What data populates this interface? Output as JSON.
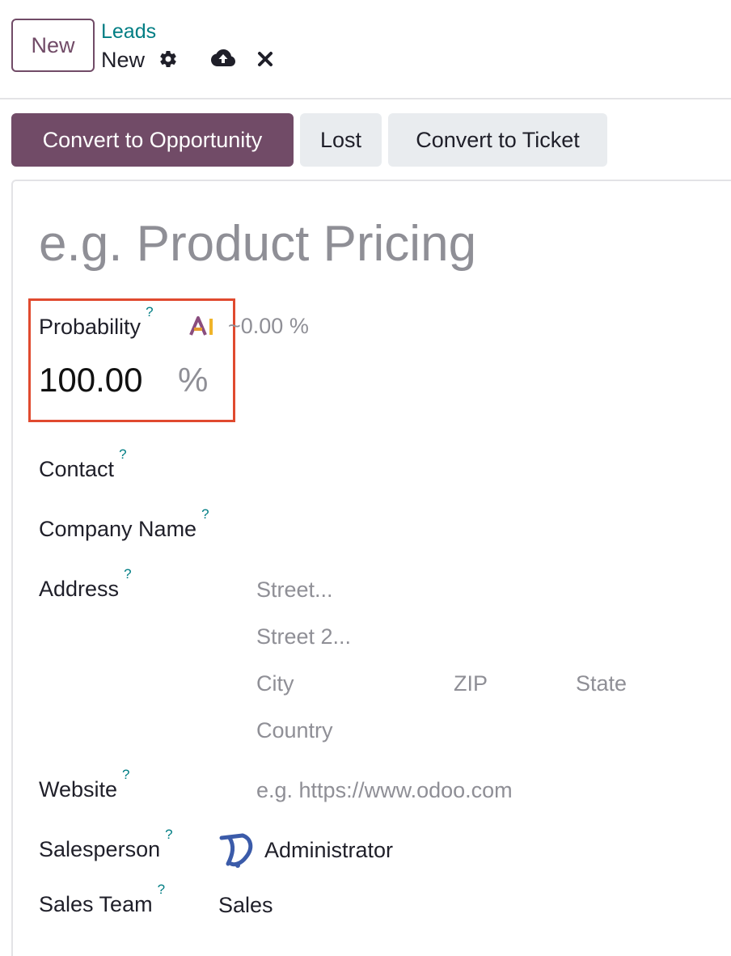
{
  "control_panel": {
    "new_button": "New",
    "breadcrumb": "Leads",
    "record_name": "New"
  },
  "status_buttons": {
    "convert_opportunity": "Convert to Opportunity",
    "lost": "Lost",
    "convert_ticket": "Convert to Ticket"
  },
  "form": {
    "title_placeholder": "e.g. Product Pricing",
    "probability": {
      "label": "Probability",
      "help": "?",
      "ai_badge": "AI",
      "ai_value": "~0.00 %",
      "value": "100.00",
      "unit": "%"
    },
    "contact": {
      "label": "Contact",
      "help": "?"
    },
    "company": {
      "label": "Company Name",
      "help": "?"
    },
    "address": {
      "label": "Address",
      "help": "?",
      "street_placeholder": "Street...",
      "street2_placeholder": "Street 2...",
      "city_placeholder": "City",
      "zip_placeholder": "ZIP",
      "state_placeholder": "State",
      "country_placeholder": "Country"
    },
    "website": {
      "label": "Website",
      "help": "?",
      "placeholder": "e.g. https://www.odoo.com"
    },
    "salesperson": {
      "label": "Salesperson",
      "help": "?",
      "value": "Administrator"
    },
    "sales_team": {
      "label": "Sales Team",
      "help": "?",
      "value": "Sales"
    }
  },
  "colors": {
    "brand": "#714b67",
    "link": "#017e84",
    "highlight": "#e04a2f",
    "muted": "#8f8f96"
  },
  "icons": {
    "settings": "gear-icon",
    "save": "cloud-upload-icon",
    "discard": "close-icon",
    "ai": "ai-icon",
    "avatar": "odoo-avatar-icon"
  }
}
